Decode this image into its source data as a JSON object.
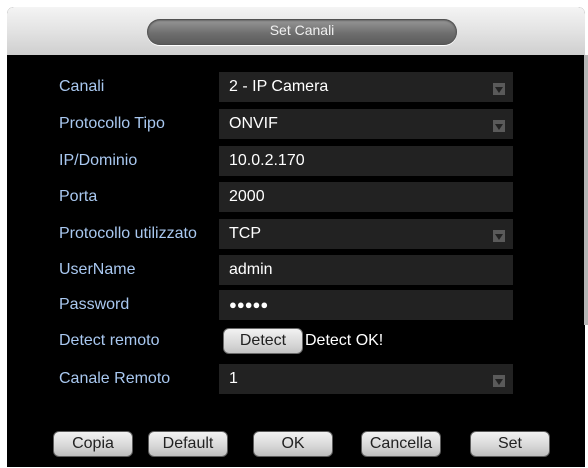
{
  "dialog": {
    "title": "Set Canali"
  },
  "fields": [
    {
      "label": "Canali",
      "value": "2 - IP Camera",
      "type": "select"
    },
    {
      "label": "Protocollo Tipo",
      "value": "ONVIF",
      "type": "select"
    },
    {
      "label": "IP/Dominio",
      "value": "10.0.2.170",
      "type": "text"
    },
    {
      "label": "Porta",
      "value": "2000",
      "type": "text"
    },
    {
      "label": "Protocollo utilizzato",
      "value": "TCP",
      "type": "select"
    },
    {
      "label": "UserName",
      "value": "admin",
      "type": "text"
    },
    {
      "label": "Password",
      "value": "●●●●●",
      "type": "password"
    },
    {
      "label": "Detect remoto",
      "button": "Detect",
      "status": "Detect OK!"
    },
    {
      "label": "Canale Remoto",
      "value": "1",
      "type": "select"
    }
  ],
  "buttons": {
    "copy": "Copia",
    "default": "Default",
    "ok": "OK",
    "cancel": "Cancella",
    "set": "Set"
  },
  "colors": {
    "background": "#000000",
    "label": "#a9c8f0",
    "field": "#222222",
    "value": "#ffffff"
  }
}
